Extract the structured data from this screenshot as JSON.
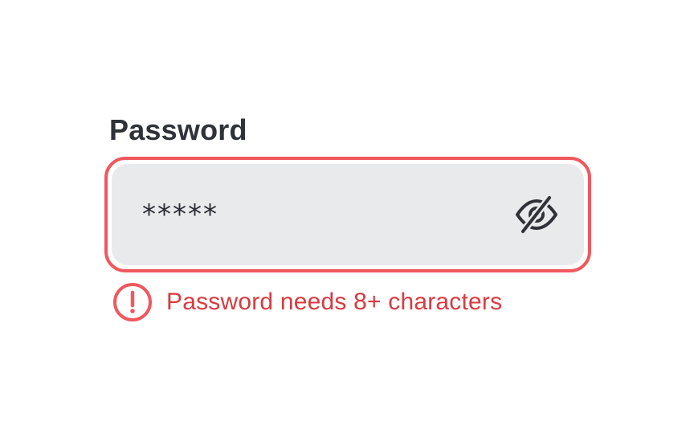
{
  "password_field": {
    "label": "Password",
    "value": "*****",
    "visibility_toggle_icon": "eye-slash-icon",
    "error_message": "Password needs 8+ characters",
    "error_icon": "exclamation-circle-icon"
  },
  "colors": {
    "error_border": "#f0585e",
    "error_text": "#d93a40",
    "input_background": "#e9eaec",
    "label_text": "#2f3238"
  }
}
